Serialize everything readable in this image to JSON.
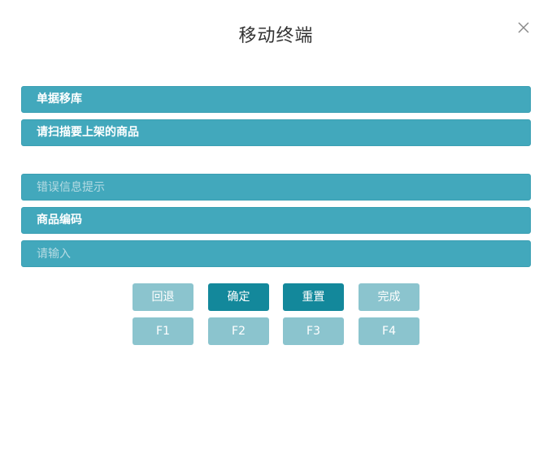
{
  "dialog": {
    "title": "移动终端",
    "close_icon": "close-icon"
  },
  "rows": {
    "move_label": "单据移库",
    "scan_prompt": "请扫描要上架的商品",
    "error_placeholder": "错误信息提示",
    "product_code_label": "商品编码",
    "input_placeholder": "请输入"
  },
  "buttons": {
    "back": "回退",
    "confirm": "确定",
    "reset": "重置",
    "finish": "完成",
    "f1": "F1",
    "f2": "F2",
    "f3": "F3",
    "f4": "F4"
  },
  "colors": {
    "bar": "#42a8bc",
    "button_light": "#8bc4ce",
    "button_dark": "#13889b"
  }
}
